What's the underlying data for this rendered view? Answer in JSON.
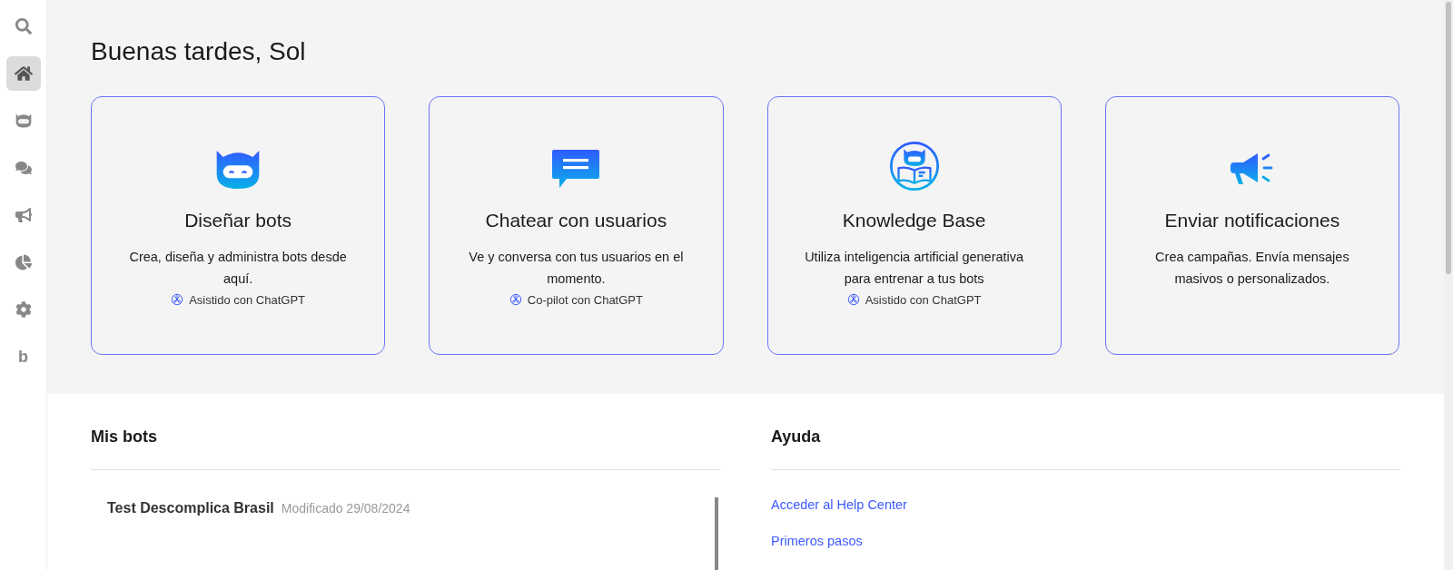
{
  "sidebar": {
    "items": [
      {
        "kind": "search",
        "selected": false
      },
      {
        "kind": "home",
        "selected": true
      },
      {
        "kind": "bot",
        "selected": false
      },
      {
        "kind": "chat",
        "selected": false
      },
      {
        "kind": "megaphone",
        "selected": false
      },
      {
        "kind": "chart",
        "selected": false
      },
      {
        "kind": "settings",
        "selected": false
      },
      {
        "kind": "letter",
        "label": "b",
        "selected": false
      }
    ]
  },
  "greeting": "Buenas tardes, Sol",
  "cards": [
    {
      "kind": "bot",
      "title": "Diseñar bots",
      "description": "Crea, diseña y administra bots desde aquí.",
      "badge": "Asistido con ChatGPT"
    },
    {
      "kind": "chat",
      "title": "Chatear con usuarios",
      "description": "Ve y conversa con tus usuarios en el momento.",
      "badge": "Co-pilot con ChatGPT"
    },
    {
      "kind": "knowledge",
      "title": "Knowledge Base",
      "description": "Utiliza inteligencia artificial generativa para entrenar a tus bots",
      "badge": "Asistido con ChatGPT"
    },
    {
      "kind": "megaphone",
      "title": "Enviar notificaciones",
      "description": "Crea campañas. Envía mensajes masivos o personalizados."
    }
  ],
  "my_bots": {
    "title": "Mis bots",
    "bots": [
      {
        "name": "Test Descomplica Brasil",
        "modified": "Modificado 29/08/2024"
      }
    ]
  },
  "help": {
    "title": "Ayuda",
    "links": [
      "Acceder al Help Center",
      "Primeros pasos"
    ]
  }
}
